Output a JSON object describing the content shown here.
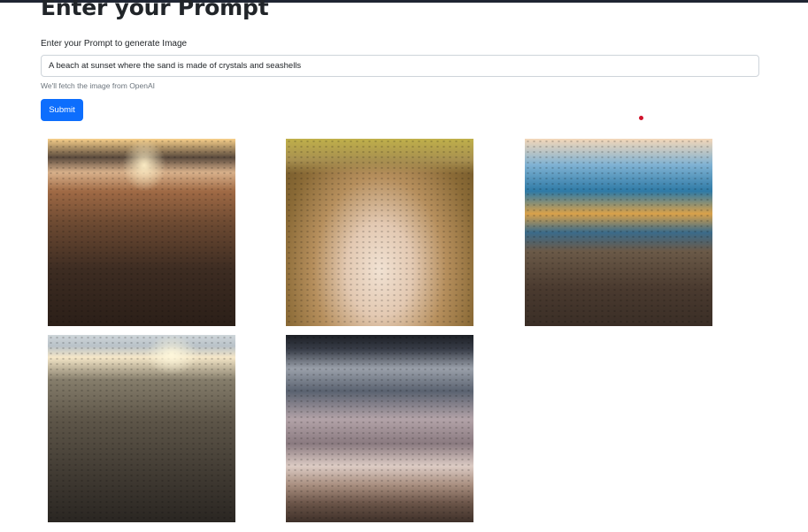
{
  "form": {
    "title": "Enter your Prompt",
    "label": "Enter your Prompt to generate Image",
    "prompt_value": "A beach at sunset where the sand is made of crystals and seashells",
    "help_text": "We'll fetch the image from OpenAI",
    "submit_label": "Submit"
  },
  "colors": {
    "primary": "#0d6efd",
    "text": "#212529",
    "muted": "#6c757d",
    "indicator": "#d0132b"
  },
  "gallery": {
    "images": [
      {
        "subject": "sunset over pebble beach"
      },
      {
        "subject": "pile of seashells in sand"
      },
      {
        "subject": "blurred ocean sunset over sand"
      },
      {
        "subject": "wet shimmering sand at sunset"
      },
      {
        "subject": "waves washing onto shore"
      }
    ]
  }
}
